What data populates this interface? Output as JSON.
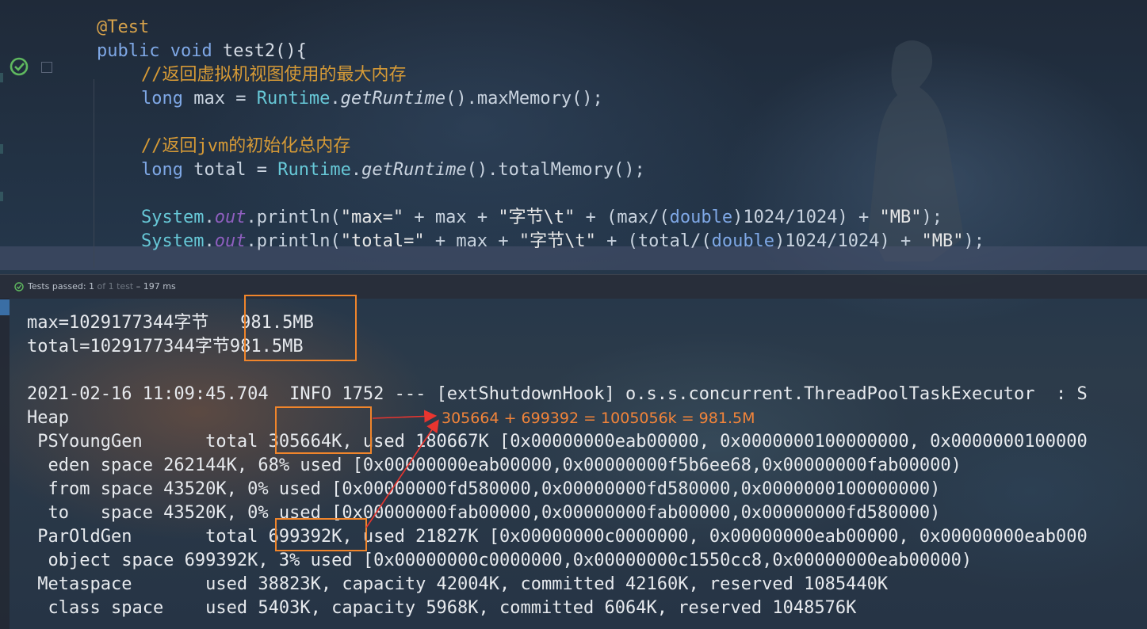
{
  "editor": {
    "lines": [
      "@Test",
      "public void test2(){",
      "    //返回虚拟机视图使用的最大内存",
      "    long max = Runtime.getRuntime().maxMemory();",
      "",
      "    //返回jvm的初始化总内存",
      "    long total = Runtime.getRuntime().totalMemory();",
      "",
      "    System.out.println(\"max=\" + max + \"字节\\t\" + (max/(double)1024/1024) + \"MB\");",
      "    System.out.println(\"total=\" + max + \"字节\\t\" + (total/(double)1024/1024) + \"MB\");"
    ]
  },
  "status": {
    "passed_label": "Tests passed: ",
    "passed_count": "1",
    "of_total": " of 1 test",
    "duration": " – 197 ms"
  },
  "console": {
    "lines": [
      "max=1029177344字节   981.5MB",
      "total=1029177344字节981.5MB",
      "",
      "2021-02-16 11:09:45.704  INFO 1752 --- [extShutdownHook] o.s.s.concurrent.ThreadPoolTaskExecutor  : S",
      "Heap",
      " PSYoungGen      total 305664K, used 180667K [0x00000000eab00000, 0x0000000100000000, 0x0000000100000",
      "  eden space 262144K, 68% used [0x00000000eab00000,0x00000000f5b6ee68,0x00000000fab00000)",
      "  from space 43520K, 0% used [0x00000000fd580000,0x00000000fd580000,0x0000000100000000)",
      "  to   space 43520K, 0% used [0x00000000fab00000,0x00000000fab00000,0x00000000fd580000)",
      " ParOldGen       total 699392K, used 21827K [0x00000000c0000000, 0x00000000eab00000, 0x00000000eab000",
      "  object space 699392K, 3% used [0x00000000c0000000,0x00000000c1550cc8,0x00000000eab00000)",
      " Metaspace       used 38823K, capacity 42004K, committed 42160K, reserved 1085440K",
      "  class space    used 5403K, capacity 5968K, committed 6064K, reserved 1048576K"
    ],
    "annotation": "305664 + 699392 = 1005056k = 981.5M"
  },
  "colors": {
    "highlight_box": "#f0852b",
    "arrow": "#e8352f",
    "annotation_text": "#f2843a",
    "test_pass": "#5fb85f"
  }
}
